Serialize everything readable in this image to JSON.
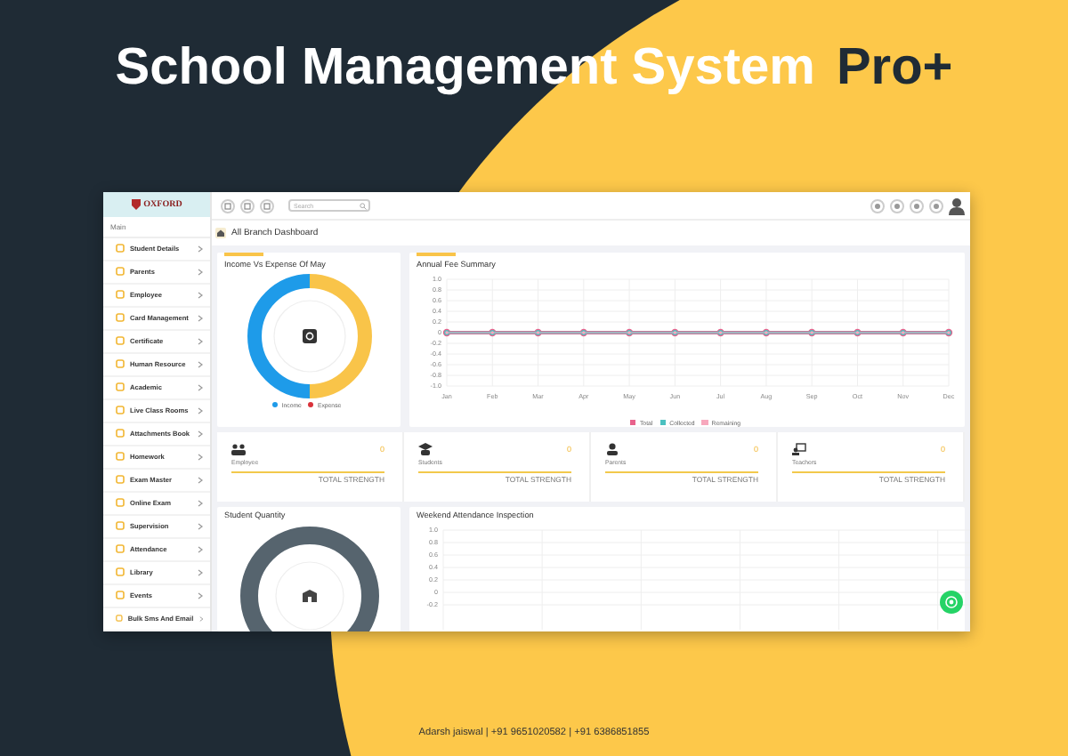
{
  "banner": {
    "title": "School Management System",
    "badge": "Pro+"
  },
  "app": {
    "logo": "OXFORD",
    "search": {
      "placeholder": "Search"
    },
    "sidebar": {
      "section": "Main",
      "items": [
        {
          "label": "Student Details"
        },
        {
          "label": "Parents"
        },
        {
          "label": "Employee"
        },
        {
          "label": "Card Management"
        },
        {
          "label": "Certificate"
        },
        {
          "label": "Human Resource"
        },
        {
          "label": "Academic"
        },
        {
          "label": "Live Class Rooms"
        },
        {
          "label": "Attachments Book"
        },
        {
          "label": "Homework"
        },
        {
          "label": "Exam Master"
        },
        {
          "label": "Online Exam"
        },
        {
          "label": "Supervision"
        },
        {
          "label": "Attendance"
        },
        {
          "label": "Library"
        },
        {
          "label": "Events"
        },
        {
          "label": "Bulk Sms And Email"
        }
      ]
    },
    "breadcrumb": "All Branch Dashboard",
    "income_card": {
      "title": "Income Vs Expense Of May",
      "legend": [
        {
          "label": "Income",
          "color": "#1e9be9"
        },
        {
          "label": "Expense",
          "color": "#d9323a"
        }
      ]
    },
    "fee_card": {
      "title": "Annual Fee Summary",
      "chart_data": {
        "type": "line",
        "categories": [
          "Jan",
          "Feb",
          "Mar",
          "Apr",
          "May",
          "Jun",
          "Jul",
          "Aug",
          "Sep",
          "Oct",
          "Nov",
          "Dec"
        ],
        "series": [
          {
            "name": "Total",
            "color": "#e8628c",
            "marker": true,
            "values": [
              0,
              0,
              0,
              0,
              0,
              0,
              0,
              0,
              0,
              0,
              0,
              0
            ]
          },
          {
            "name": "Collected",
            "color": "#4bc0c0",
            "marker": true,
            "values": [
              0,
              0,
              0,
              0,
              0,
              0,
              0,
              0,
              0,
              0,
              0,
              0
            ]
          },
          {
            "name": "Remaining",
            "color": "#f7a8bd",
            "marker": true,
            "values": [
              0,
              0,
              0,
              0,
              0,
              0,
              0,
              0,
              0,
              0,
              0,
              0
            ]
          }
        ],
        "ylim": [
          -1,
          1
        ],
        "grid": true,
        "yticks": [
          {
            "value": 1,
            "label": "1.0"
          },
          0.8,
          0.6,
          0.4,
          0.2,
          0,
          -0.2,
          -0.4,
          -0.6,
          -0.8,
          {
            "value": -1,
            "label": "-1.0"
          }
        ]
      }
    },
    "stats": [
      {
        "label": "Employee",
        "value": "0",
        "caption": "TOTAL STRENGTH"
      },
      {
        "label": "Students",
        "value": "0",
        "caption": "TOTAL STRENGTH"
      },
      {
        "label": "Parents",
        "value": "0",
        "caption": "TOTAL STRENGTH"
      },
      {
        "label": "Teachers",
        "value": "0",
        "caption": "TOTAL STRENGTH"
      }
    ],
    "quantity_card": {
      "title": "Student Quantity"
    },
    "attendance_card": {
      "title": "Weekend Attendance Inspection",
      "chart_data": {
        "type": "line",
        "categories": [
          null,
          null,
          null,
          null,
          null,
          null,
          null
        ],
        "grid": true,
        "ylim": [
          -0.6,
          1
        ],
        "yticks": [
          {
            "value": 1,
            "label": "1.0"
          },
          0.8,
          0.6,
          0.4,
          0.2,
          0,
          -0.2
        ]
      }
    }
  },
  "footer": "Adarsh jaiswal | +91 9651020582 | +91 6386851855"
}
